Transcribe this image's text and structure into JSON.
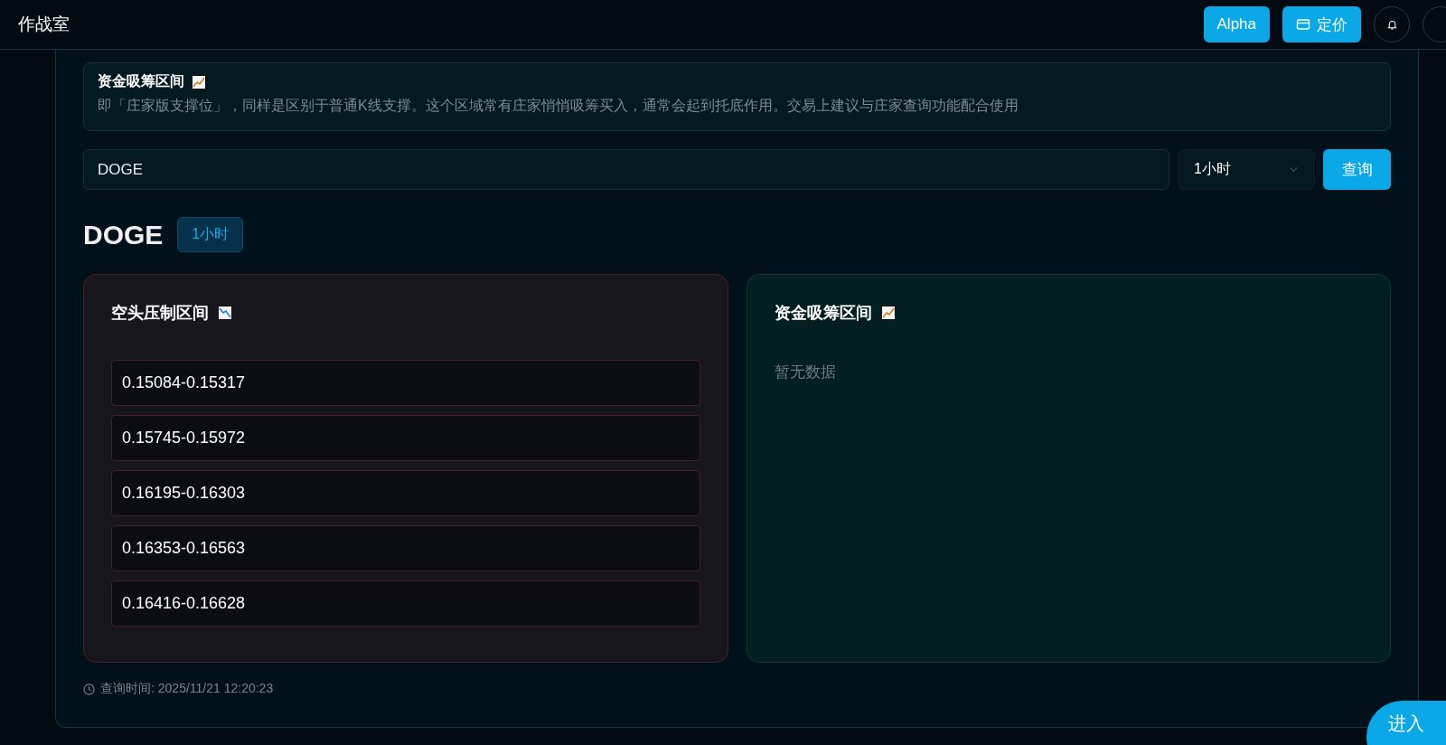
{
  "header": {
    "title": "作战室",
    "buttons": [
      {
        "label": "Alpha",
        "kind": "plain"
      },
      {
        "label": "定价",
        "kind": "card"
      }
    ]
  },
  "info": {
    "title": "资金吸筹区间",
    "description": "即「庄家版支撑位」，同样是区别于普通K线支撑。这个区域常有庄家悄悄吸筹买入，通常会起到托底作用。交易上建议与庄家查询功能配合使用"
  },
  "query": {
    "value": "DOGE",
    "interval": "1小时",
    "button": "查询"
  },
  "result": {
    "symbol": "DOGE",
    "interval": "1小时"
  },
  "panels": [
    {
      "kind": "short",
      "title": "空头压制区间",
      "ranges": [
        "0.15084-0.15317",
        "0.15745-0.15972",
        "0.16195-0.16303",
        "0.16353-0.16563",
        "0.16416-0.16628"
      ]
    },
    {
      "kind": "accumulation",
      "title": "资金吸筹区间",
      "empty_text": "暂无数据"
    }
  ],
  "query_time": "查询时间: 2025/11/21 12:20:23",
  "float_button": "进入"
}
